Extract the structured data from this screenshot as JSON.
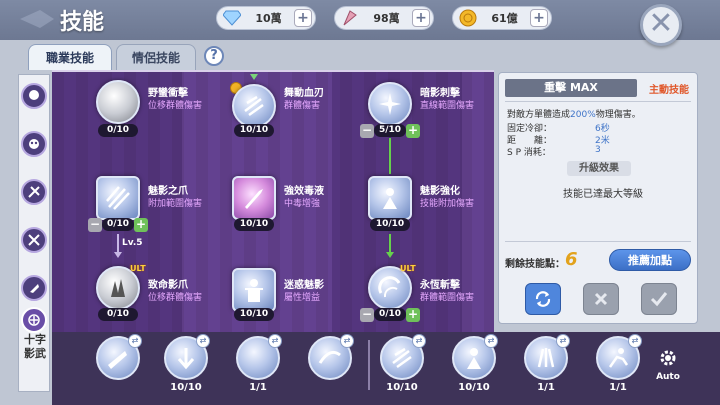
{
  "header": {
    "title": "技能",
    "currencies": [
      {
        "icon": "diamond-icon",
        "value": "10萬"
      },
      {
        "icon": "feather-crystal-icon",
        "value": "98萬"
      },
      {
        "icon": "gold-coin-icon",
        "value": "61億"
      }
    ],
    "plus": "+",
    "close": "✕"
  },
  "tabs": [
    {
      "label": "職業技能"
    },
    {
      "label": "情侶技能"
    }
  ],
  "help": "?",
  "job_label": "十字影武",
  "tree": {
    "skills": [
      {
        "name": "野蠻衝擊",
        "desc": "位移群體傷害",
        "level": "0/10"
      },
      {
        "name": "舞動血刃",
        "desc": "群體傷害",
        "level": "10/10"
      },
      {
        "name": "暗影刺擊",
        "desc": "直線範圍傷害",
        "level": "5/10"
      },
      {
        "name": "魅影之爪",
        "desc": "附加範圍傷害",
        "level": "0/10"
      },
      {
        "name": "強效毒液",
        "desc": "中毒增強",
        "level": "10/10"
      },
      {
        "name": "魅影強化",
        "desc": "技能附加傷害",
        "level": "10/10"
      },
      {
        "name": "致命影爪",
        "desc": "位移群體傷害",
        "level": "0/10"
      },
      {
        "name": "迷惑魅影",
        "desc": "屬性增益",
        "level": "10/10"
      },
      {
        "name": "永恆斬擊",
        "desc": "群體範圍傷害",
        "level": "0/10"
      }
    ],
    "req_label": "Lv.5",
    "ult": "ULT",
    "minus": "−",
    "plus": "+"
  },
  "info": {
    "skill_title": "重擊 MAX",
    "skill_type": "主動技能",
    "desc_prefix": "對敵方單體造成",
    "desc_value": "200%",
    "desc_suffix": "物理傷害。",
    "cooldown_label": "固定冷卻：",
    "cooldown_value": "6秒",
    "distance_label": "距　　離：",
    "distance_value": "2米",
    "sp_label": "S P 消耗：",
    "sp_value": "3",
    "upgrade_label": "升級效果",
    "max_text": "技能已達最大等級",
    "remain_label": "剩餘技能點：",
    "remain_value": "6",
    "recommend_label": "推薦加點"
  },
  "bottom_bar": {
    "slots": [
      {
        "count": ""
      },
      {
        "count": "10/10"
      },
      {
        "count": "1/1"
      },
      {
        "count": ""
      },
      {
        "count": "10/10"
      },
      {
        "count": "10/10"
      },
      {
        "count": "1/1"
      },
      {
        "count": "1/1"
      }
    ],
    "auto_label": "Auto"
  },
  "colors": {
    "accent": "#3c6fc6",
    "tree_bg": "#5e3d86",
    "skill_type": "#e0572a",
    "value_blue": "#3f74c8",
    "points": "#e2a21c"
  }
}
